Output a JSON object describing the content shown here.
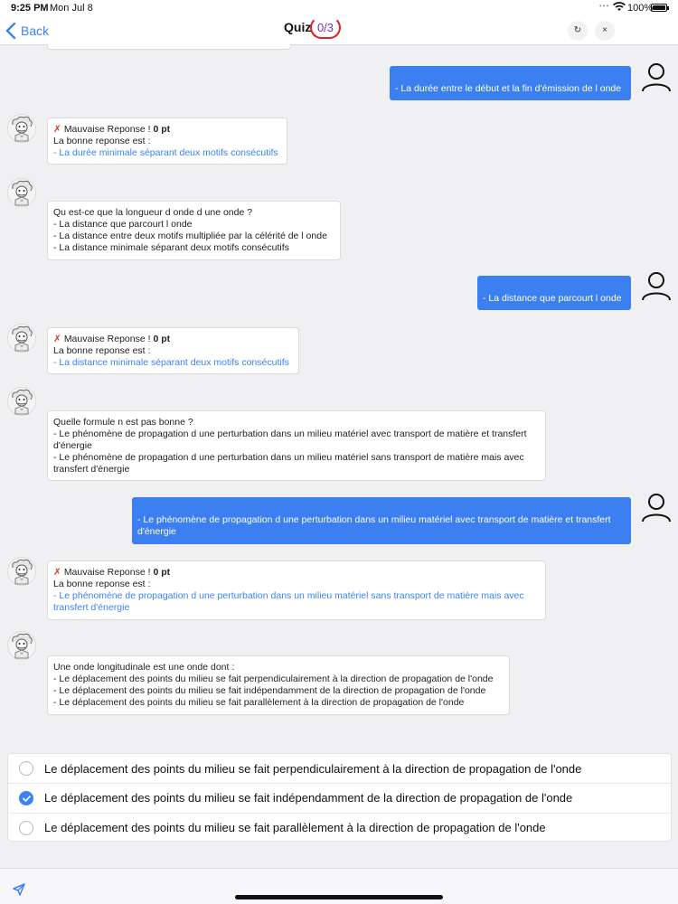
{
  "status_bar": {
    "time": "9:25 PM",
    "date": "Mon Jul 8",
    "battery": "100%"
  },
  "nav": {
    "back_label": "Back",
    "title": "Quiz",
    "score": "0/3",
    "refresh_icon": "↻",
    "close_icon": "×"
  },
  "colors": {
    "accent": "#3b82f6",
    "user_bubble": "#3b7ff0",
    "wrong": "#d93a2b",
    "score_text": "#7a2db5",
    "score_ring": "#e02020"
  },
  "messages": {
    "m1_user": "- La durée entre le début et la fin d'émission de l onde",
    "m2_bot": {
      "wrong_prefix": "Mauvaise Reponse ! ",
      "points": "0 pt",
      "correct_intro": "La bonne reponse est :",
      "correct": "- La durée minimale séparant deux motifs consécutifs"
    },
    "m3_bot": {
      "question": "Qu est-ce que la longueur d onde d une onde ?",
      "choices": [
        "- La distance que parcourt l onde",
        "- La distance entre deux motifs multipliée par la célérité de l onde",
        "- La distance minimale séparant deux motifs consécutifs"
      ]
    },
    "m4_user": "- La distance que parcourt l onde",
    "m5_bot": {
      "wrong_prefix": "Mauvaise Reponse ! ",
      "points": "0 pt",
      "correct_intro": "La bonne reponse est :",
      "correct": "- La distance minimale séparant deux motifs consécutifs"
    },
    "m6_bot": {
      "question": "Quelle formule n est pas bonne ?",
      "choices": [
        "- Le phénomène de propagation d une perturbation dans un milieu matériel avec transport de matière et transfert d'énergie",
        "- Le phénomène de propagation d une perturbation dans un milieu matériel sans transport de matière mais avec transfert d'énergie"
      ]
    },
    "m7_user": "- Le phénomène de propagation d une perturbation dans un milieu matériel avec transport de matière et transfert d'énergie",
    "m8_bot": {
      "wrong_prefix": "Mauvaise Reponse ! ",
      "points": "0 pt",
      "correct_intro": "La bonne reponse est :",
      "correct": "- Le phénomène de propagation d une perturbation dans un milieu matériel sans transport de matière mais avec transfert d'énergie"
    },
    "m9_bot": {
      "question": "Une onde longitudinale est une onde dont :",
      "choices": [
        "- Le déplacement des points du milieu se fait perpendiculairement à la direction de propagation de l'onde",
        "- Le déplacement des points du milieu se fait indépendamment de la direction de propagation de l'onde",
        "- Le déplacement des points du milieu se fait parallèlement à la direction de propagation de l'onde"
      ]
    }
  },
  "answer_options": [
    {
      "label": "Le déplacement des points du milieu se fait perpendiculairement à la direction de propagation de l'onde",
      "selected": false
    },
    {
      "label": "Le déplacement des points du milieu se fait indépendamment de la direction de propagation de l'onde",
      "selected": true
    },
    {
      "label": "Le déplacement des points du milieu se fait parallèlement à la direction de propagation de l'onde",
      "selected": false
    }
  ],
  "icons": {
    "bot_avatar": "scientist-avatar-icon",
    "user_avatar": "user-avatar-icon",
    "send": "send-icon"
  }
}
